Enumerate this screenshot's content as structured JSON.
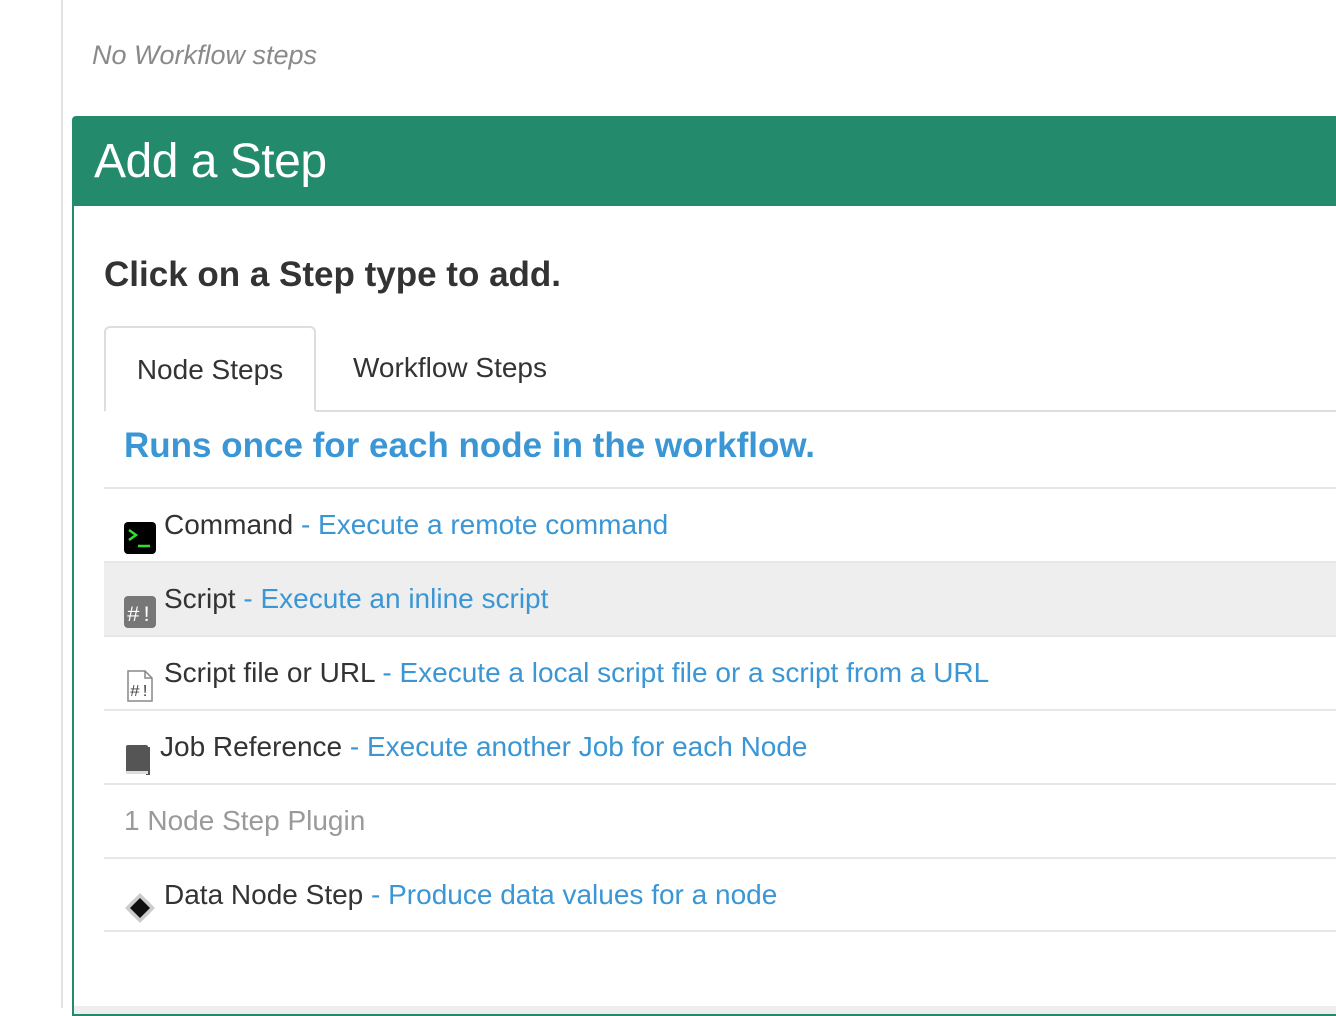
{
  "workflow": {
    "empty_text": "No Workflow steps"
  },
  "add_step": {
    "title": "Add a Step",
    "instruction": "Click on a Step type to add.",
    "tabs": [
      {
        "label": "Node Steps",
        "active": true
      },
      {
        "label": "Workflow Steps",
        "active": false
      }
    ],
    "node_steps_header": "Runs once for each node in the workflow.",
    "steps": [
      {
        "icon": "terminal-icon",
        "name": "Command",
        "desc": "- Execute a remote command"
      },
      {
        "icon": "script-icon",
        "name": "Script",
        "desc": "- Execute an inline script"
      },
      {
        "icon": "script-file-icon",
        "name": "Script file or URL",
        "desc": "- Execute a local script file or a script from a URL"
      },
      {
        "icon": "book-icon",
        "name": "Job Reference",
        "desc": "- Execute another Job for each Node"
      }
    ],
    "plugin_count_label": "1 Node Step Plugin",
    "plugins": [
      {
        "icon": "diamond-icon",
        "name": "Data Node Step",
        "desc": "- Produce data values for a node"
      }
    ]
  },
  "colors": {
    "header_green": "#238b6b",
    "link_blue": "#3a96d4",
    "hover_row": "#eeeeee"
  }
}
